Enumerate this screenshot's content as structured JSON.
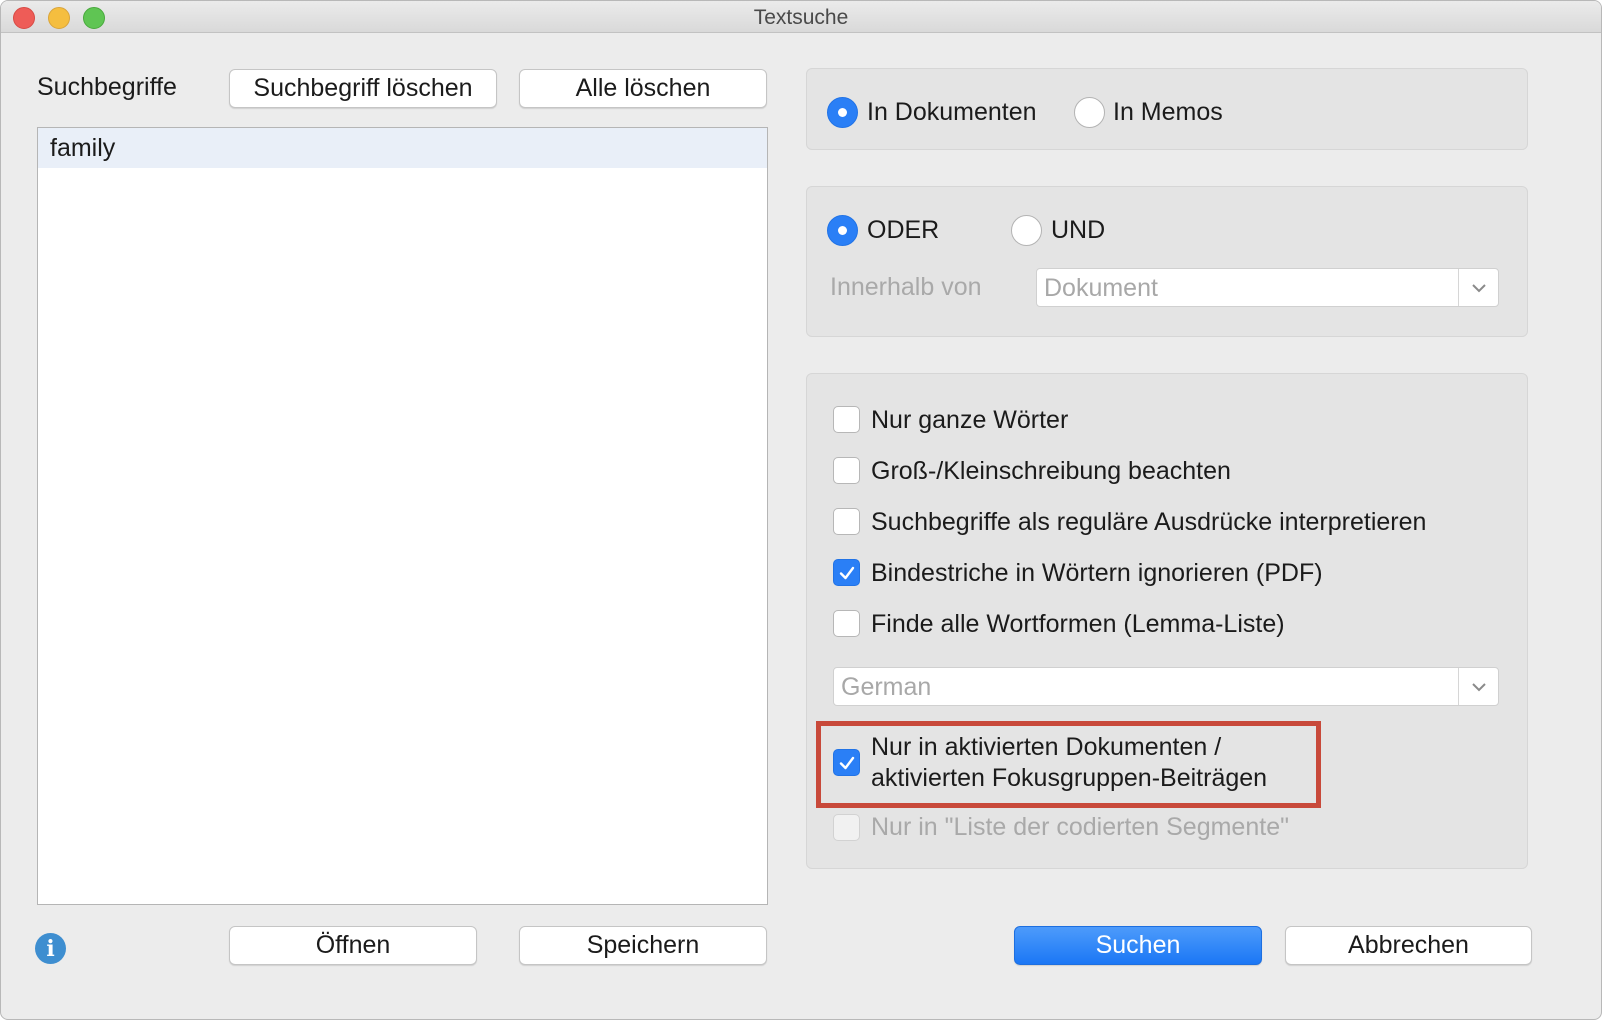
{
  "window": {
    "title": "Textsuche"
  },
  "search_terms": {
    "label": "Suchbegriffe",
    "delete_term_button": "Suchbegriff löschen",
    "delete_all_button": "Alle löschen",
    "items": [
      "family"
    ],
    "open_button": "Öffnen",
    "save_button": "Speichern"
  },
  "scope": {
    "in_documents": {
      "label": "In Dokumenten",
      "selected": true
    },
    "in_memos": {
      "label": "In Memos",
      "selected": false
    }
  },
  "logic": {
    "or": {
      "label": "ODER",
      "selected": true
    },
    "and": {
      "label": "UND",
      "selected": false
    },
    "within_label": "Innerhalb von",
    "within_value": "Dokument"
  },
  "options": {
    "whole_words": {
      "label": "Nur ganze Wörter",
      "checked": false
    },
    "case_sensitive": {
      "label": "Groß-/Kleinschreibung beachten",
      "checked": false
    },
    "regex": {
      "label": "Suchbegriffe als reguläre Ausdrücke interpretieren",
      "checked": false
    },
    "ignore_hyphens": {
      "label": "Bindestriche in Wörtern ignorieren (PDF)",
      "checked": true
    },
    "lemma": {
      "label": "Finde alle Wortformen (Lemma-Liste)",
      "checked": false
    },
    "language_value": "German",
    "activated_docs": {
      "label_line1": "Nur in aktivierten Dokumenten /",
      "label_line2": "aktivierten Fokusgruppen-Beiträgen",
      "checked": true
    },
    "coded_segments": {
      "label": "Nur in \"Liste der codierten Segmente\"",
      "checked": false,
      "disabled": true
    }
  },
  "actions": {
    "search_button": "Suchen",
    "cancel_button": "Abbrechen"
  },
  "colors": {
    "accent": "#2a7ff6",
    "highlight_border": "#c8493a",
    "window_bg": "#ececec"
  }
}
